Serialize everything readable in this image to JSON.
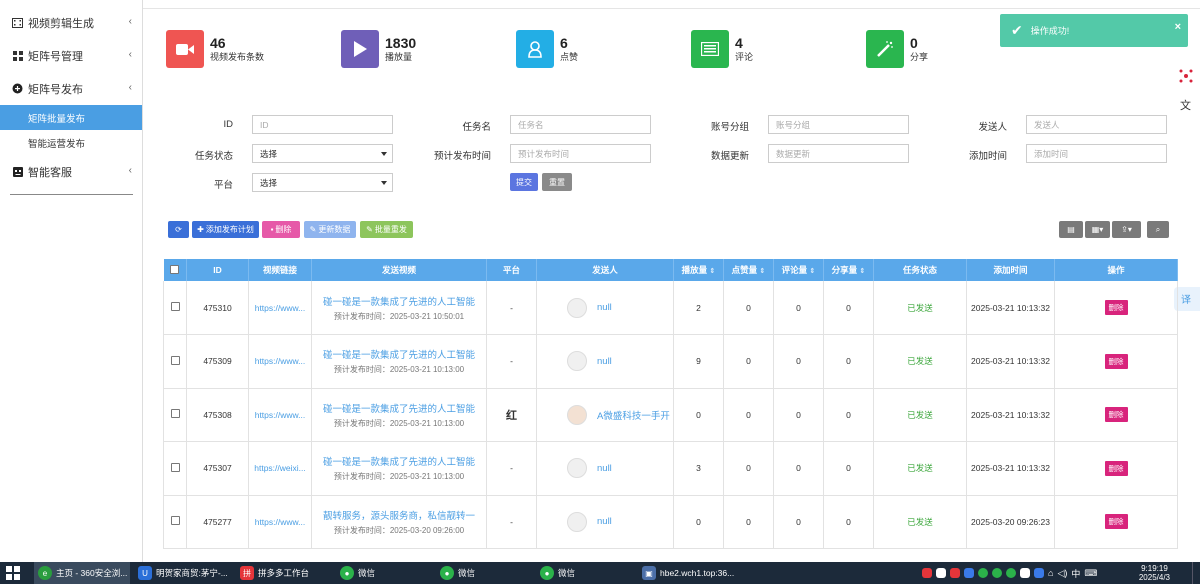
{
  "sidebar": {
    "items": [
      {
        "label": "视频剪辑生成",
        "icon": "film-icon"
      },
      {
        "label": "矩阵号管理",
        "icon": "grid-icon"
      },
      {
        "label": "矩阵号发布",
        "icon": "plus-circle-icon"
      },
      {
        "label": "智能客服",
        "icon": "robot-icon"
      }
    ],
    "subitems": [
      {
        "label": "矩阵批量发布",
        "active": true
      },
      {
        "label": "智能运营发布",
        "active": false
      }
    ]
  },
  "stats": [
    {
      "value": "46",
      "label": "视频发布条数",
      "color": "#ef5552",
      "icon": "video-camera-icon"
    },
    {
      "value": "1830",
      "label": "播放量",
      "color": "#6f5fb8",
      "icon": "play-icon"
    },
    {
      "value": "6",
      "label": "点赞",
      "color": "#23aee5",
      "icon": "user-icon"
    },
    {
      "value": "4",
      "label": "评论",
      "color": "#2ab64f",
      "icon": "list-icon"
    },
    {
      "value": "0",
      "label": "分享",
      "color": "#2ab64f",
      "icon": "magic-wand-icon"
    }
  ],
  "toast": {
    "message": "操作成功!",
    "close": "×"
  },
  "filters": {
    "id_label": "ID",
    "id_placeholder": "ID",
    "task_name_label": "任务名",
    "task_name_placeholder": "任务名",
    "account_group_label": "账号分组",
    "account_group_placeholder": "账号分组",
    "sender_label": "发送人",
    "sender_placeholder": "发送人",
    "task_status_label": "任务状态",
    "task_status_value": "选择",
    "planned_time_label": "预计发布时间",
    "planned_time_placeholder": "预计发布时间",
    "data_update_label": "数据更新",
    "data_update_placeholder": "数据更新",
    "add_time_label": "添加时间",
    "add_time_placeholder": "添加时间",
    "platform_label": "平台",
    "platform_value": "选择",
    "submit": "提交",
    "reset": "重置"
  },
  "toolbar": {
    "add_plan": "添加发布计划",
    "delete": "删除",
    "update_data": "更新数据",
    "batch_resend": "批量重发"
  },
  "table": {
    "headers": [
      "ID",
      "视频链接",
      "发送视频",
      "平台",
      "发送人",
      "播放量",
      "点赞量",
      "评论量",
      "分享量",
      "任务状态",
      "添加时间",
      "操作"
    ],
    "delete_label": "删除",
    "rows": [
      {
        "id": "475310",
        "link": "https://www...",
        "title": "碰一碰是一款集成了先进的人工智能",
        "planned": "预计发布时间：2025-03-21 10:50:01",
        "platform": "-",
        "sender": "null",
        "plays": "2",
        "likes": "0",
        "comments": "0",
        "shares": "0",
        "status": "已发送",
        "added": "2025-03-21 10:13:32"
      },
      {
        "id": "475309",
        "link": "https://www...",
        "title": "碰一碰是一款集成了先进的人工智能",
        "planned": "预计发布时间：2025-03-21 10:13:00",
        "platform": "-",
        "sender": "null",
        "plays": "9",
        "likes": "0",
        "comments": "0",
        "shares": "0",
        "status": "已发送",
        "added": "2025-03-21 10:13:32"
      },
      {
        "id": "475308",
        "link": "https://www...",
        "title": "碰一碰是一款集成了先进的人工智能",
        "planned": "预计发布时间：2025-03-21 10:13:00",
        "platform": "红",
        "sender": "A微盛科技一手开",
        "plays": "0",
        "likes": "0",
        "comments": "0",
        "shares": "0",
        "status": "已发送",
        "added": "2025-03-21 10:13:32"
      },
      {
        "id": "475307",
        "link": "https://weixi...",
        "title": "碰一碰是一款集成了先进的人工智能",
        "planned": "预计发布时间：2025-03-21 10:13:00",
        "platform": "-",
        "sender": "null",
        "plays": "3",
        "likes": "0",
        "comments": "0",
        "shares": "0",
        "status": "已发送",
        "added": "2025-03-21 10:13:32"
      },
      {
        "id": "475277",
        "link": "https://www...",
        "title": "靓转服务，源头服务商，私信靓转一",
        "planned": "预计发布时间：2025-03-20 09:26:00",
        "platform": "-",
        "sender": "null",
        "plays": "0",
        "likes": "0",
        "comments": "0",
        "shares": "0",
        "status": "已发送",
        "added": "2025-03-20 09:26:23"
      }
    ]
  },
  "taskbar": {
    "items": [
      {
        "label": "主页 - 360安全浏..."
      },
      {
        "label": "明贺家商贸:茅宁-..."
      },
      {
        "label": "拼多多工作台"
      },
      {
        "label": "微信"
      },
      {
        "label": "微信"
      },
      {
        "label": "微信"
      },
      {
        "label": "hbe2.wch1.top:36..."
      }
    ],
    "ime": "中",
    "time": "9:19:19",
    "date": "2025/4/3"
  }
}
